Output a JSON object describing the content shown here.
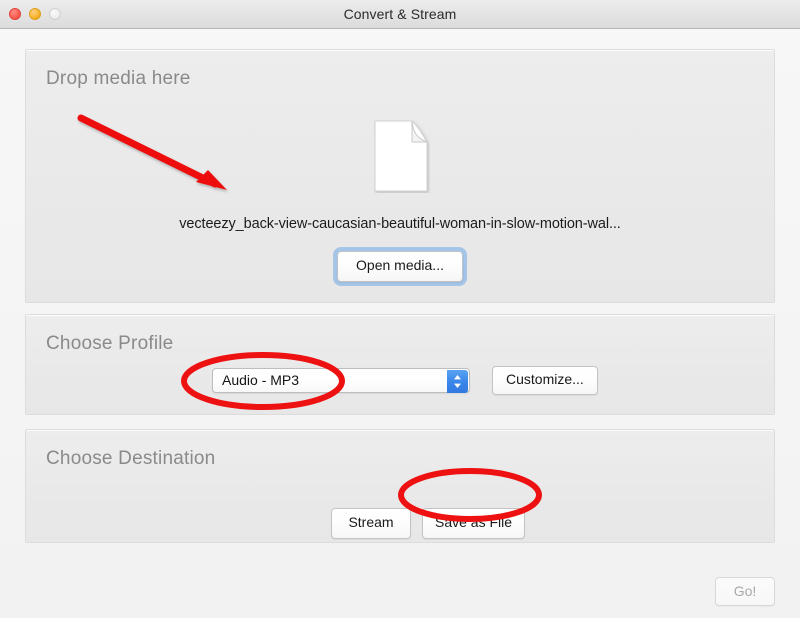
{
  "window": {
    "title": "Convert & Stream",
    "traffic_lights": [
      {
        "name": "close-button",
        "label": "close"
      },
      {
        "name": "minimize-button",
        "label": "minimize"
      },
      {
        "name": "zoom-button",
        "label": "zoom"
      }
    ]
  },
  "drop_media": {
    "section_title": "Drop media here",
    "file_icon": "document-icon",
    "filename": "vecteezy_back-view-caucasian-beautiful-woman-in-slow-motion-wal...",
    "open_media_label": "Open media..."
  },
  "profile": {
    "section_title": "Choose Profile",
    "selected": "Audio - MP3",
    "stepper_icon": "chevron-up-down-icon",
    "customize_label": "Customize..."
  },
  "destination": {
    "section_title": "Choose Destination",
    "stream_label": "Stream",
    "save_as_file_label": "Save as File"
  },
  "footer": {
    "go_label": "Go!",
    "go_disabled": true
  },
  "annotations": {
    "color": "#ee1111",
    "arrow": "red-arrow-pointing-to-file-area",
    "ellipse_profile": "red-ellipse-around-profile-dropdown",
    "ellipse_save": "red-ellipse-around-save-as-file"
  }
}
